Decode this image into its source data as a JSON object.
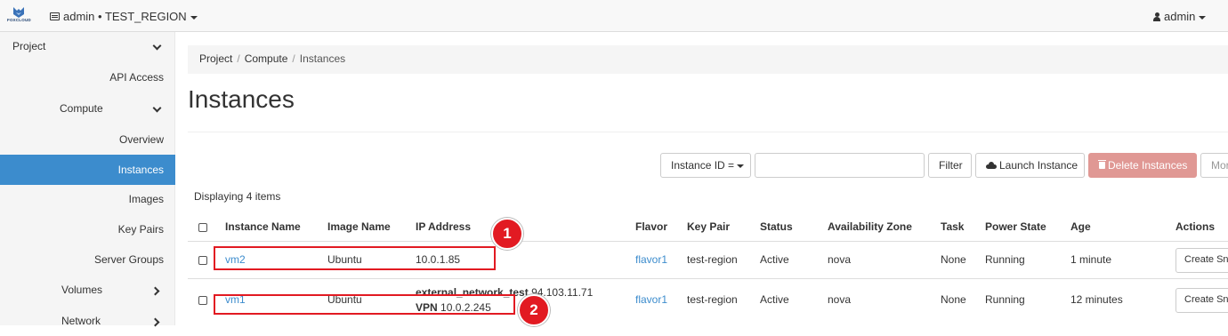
{
  "topbar": {
    "logo_text": "FOXCLOUD",
    "project_switch": "admin • TEST_REGION",
    "user": "admin"
  },
  "sidebar": {
    "items": [
      {
        "label": "Project"
      },
      {
        "label": "API Access"
      },
      {
        "label": "Compute"
      },
      {
        "label": "Overview"
      },
      {
        "label": "Instances"
      },
      {
        "label": "Images"
      },
      {
        "label": "Key Pairs"
      },
      {
        "label": "Server Groups"
      },
      {
        "label": "Volumes"
      },
      {
        "label": "Network"
      }
    ]
  },
  "breadcrumb": [
    "Project",
    "Compute",
    "Instances"
  ],
  "page_title": "Instances",
  "toolbar": {
    "filter_field": "Instance ID =",
    "filter_value": "",
    "filter_button": "Filter",
    "launch_button": "Launch Instance",
    "delete_button": "Delete Instances",
    "more_button": "Mor"
  },
  "table": {
    "displaying": "Displaying 4 items",
    "columns": [
      "Instance Name",
      "Image Name",
      "IP Address",
      "Flavor",
      "Key Pair",
      "Status",
      "Availability Zone",
      "Task",
      "Power State",
      "Age",
      "Actions"
    ],
    "rows": [
      {
        "name": "vm2",
        "image": "Ubuntu",
        "ip_line1": "10.0.1.85",
        "flavor": "flavor1",
        "keypair": "test-region",
        "status": "Active",
        "zone": "nova",
        "task": "None",
        "power": "Running",
        "age": "1 minute",
        "action": "Create Sna"
      },
      {
        "name": "vm1",
        "image": "Ubuntu",
        "ip_net1_label": "external_network_test",
        "ip_net1_value": "94.103.11.71",
        "ip_net2_label": "VPN",
        "ip_net2_value": "10.0.2.245",
        "flavor": "flavor1",
        "keypair": "test-region",
        "status": "Active",
        "zone": "nova",
        "task": "None",
        "power": "Running",
        "age": "12 minutes",
        "action": "Create Sna"
      }
    ]
  },
  "annotations": [
    "1",
    "2"
  ],
  "colors": {
    "accent": "#3c8ccd",
    "danger": "#e09894",
    "annotation": "#e21a22"
  }
}
